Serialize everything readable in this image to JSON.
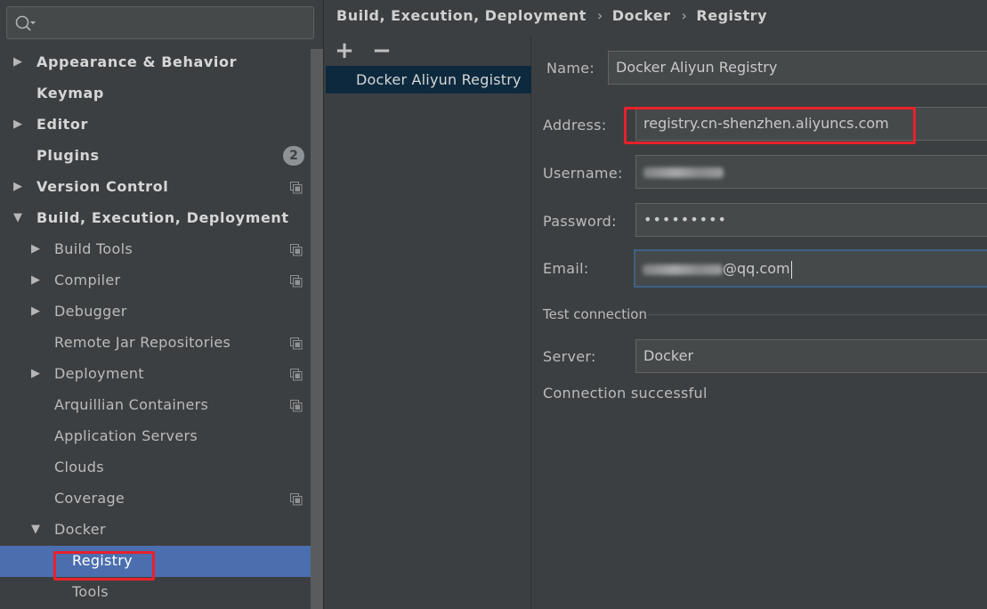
{
  "search": {
    "placeholder": ""
  },
  "tree": [
    {
      "label": "Appearance & Behavior",
      "bold": true,
      "arrow": "right",
      "indent": 0
    },
    {
      "label": "Keymap",
      "bold": true,
      "arrow": "",
      "indent": 0
    },
    {
      "label": "Editor",
      "bold": true,
      "arrow": "right",
      "indent": 0
    },
    {
      "label": "Plugins",
      "bold": true,
      "arrow": "",
      "indent": 0,
      "badge": "2"
    },
    {
      "label": "Version Control",
      "bold": true,
      "arrow": "right",
      "indent": 0,
      "project_icon": true
    },
    {
      "label": "Build, Execution, Deployment",
      "bold": true,
      "arrow": "down",
      "indent": 0
    },
    {
      "label": "Build Tools",
      "bold": false,
      "arrow": "right",
      "indent": 1,
      "project_icon": true
    },
    {
      "label": "Compiler",
      "bold": false,
      "arrow": "right",
      "indent": 1,
      "project_icon": true
    },
    {
      "label": "Debugger",
      "bold": false,
      "arrow": "right",
      "indent": 1
    },
    {
      "label": "Remote Jar Repositories",
      "bold": false,
      "arrow": "",
      "indent": 1,
      "project_icon": true
    },
    {
      "label": "Deployment",
      "bold": false,
      "arrow": "right",
      "indent": 1,
      "project_icon": true
    },
    {
      "label": "Arquillian Containers",
      "bold": false,
      "arrow": "",
      "indent": 1,
      "project_icon": true
    },
    {
      "label": "Application Servers",
      "bold": false,
      "arrow": "",
      "indent": 1
    },
    {
      "label": "Clouds",
      "bold": false,
      "arrow": "",
      "indent": 1
    },
    {
      "label": "Coverage",
      "bold": false,
      "arrow": "",
      "indent": 1,
      "project_icon": true
    },
    {
      "label": "Docker",
      "bold": false,
      "arrow": "down",
      "indent": 1
    },
    {
      "label": "Registry",
      "bold": false,
      "arrow": "",
      "indent": 2,
      "selected": true
    },
    {
      "label": "Tools",
      "bold": false,
      "arrow": "",
      "indent": 2
    }
  ],
  "breadcrumb": [
    "Build, Execution, Deployment",
    "Docker",
    "Registry"
  ],
  "breadcrumb_separator": "›",
  "registry_list": {
    "add_label": "+",
    "remove_label": "−",
    "items": [
      "Docker Aliyun Registry"
    ]
  },
  "form": {
    "name_label": "Name:",
    "name_value": "Docker Aliyun Registry",
    "address_label": "Address:",
    "address_value": "registry.cn-shenzhen.aliyuncs.com",
    "username_label": "Username:",
    "password_label": "Password:",
    "password_value": "•••••••••",
    "email_label": "Email:",
    "email_suffix": "@qq.com",
    "test_connection_label": "Test connection",
    "server_label": "Server:",
    "server_value": "Docker",
    "status_text": "Connection successful"
  },
  "colors": {
    "selection": "#4b6eaf",
    "highlight_box": "#e8212b",
    "background": "#3c3f41"
  }
}
